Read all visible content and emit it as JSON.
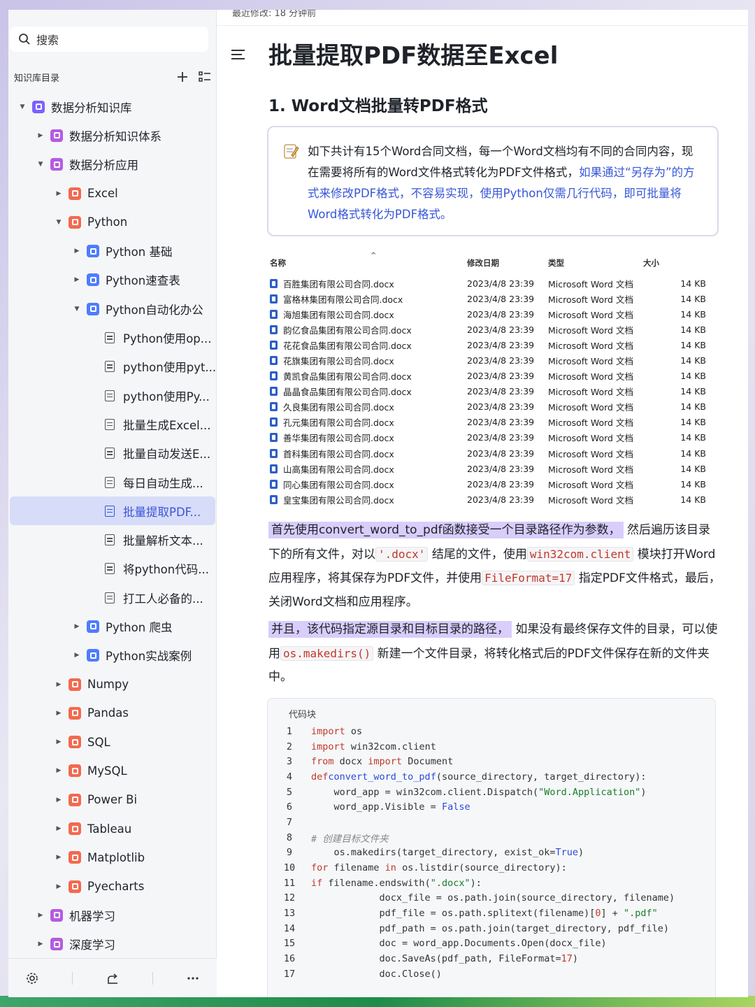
{
  "sidebar": {
    "search_placeholder": "搜索",
    "kb_title": "知识库目录",
    "items": [
      {
        "label": "数据分析知识库",
        "level": 0,
        "caret": "▼",
        "icon": "purple"
      },
      {
        "label": "数据分析知识体系",
        "level": 1,
        "caret": "▶",
        "icon": "pink"
      },
      {
        "label": "数据分析应用",
        "level": 1,
        "caret": "▼",
        "icon": "pink"
      },
      {
        "label": "Excel",
        "level": 2,
        "caret": "▶",
        "icon": "red"
      },
      {
        "label": "Python",
        "level": 2,
        "caret": "▼",
        "icon": "red"
      },
      {
        "label": "Python 基础",
        "level": 3,
        "caret": "▶",
        "icon": "blue"
      },
      {
        "label": "Python速查表",
        "level": 3,
        "caret": "▶",
        "icon": "blue"
      },
      {
        "label": "Python自动化办公",
        "level": 3,
        "caret": "▼",
        "icon": "blue"
      },
      {
        "label": "Python使用op...",
        "level": 4,
        "caret": "",
        "icon": "doc"
      },
      {
        "label": "python使用pyt...",
        "level": 4,
        "caret": "",
        "icon": "doc"
      },
      {
        "label": "python使用Py...",
        "level": 4,
        "caret": "",
        "icon": "doc"
      },
      {
        "label": "批量生成Excel...",
        "level": 4,
        "caret": "",
        "icon": "doc"
      },
      {
        "label": "批量自动发送E...",
        "level": 4,
        "caret": "",
        "icon": "doc"
      },
      {
        "label": "每日自动生成...",
        "level": 4,
        "caret": "",
        "icon": "doc"
      },
      {
        "label": "批量提取PDF...",
        "level": 4,
        "caret": "",
        "icon": "doc",
        "active": true
      },
      {
        "label": "批量解析文本...",
        "level": 4,
        "caret": "",
        "icon": "doc"
      },
      {
        "label": "将python代码...",
        "level": 4,
        "caret": "",
        "icon": "doc"
      },
      {
        "label": "打工人必备的...",
        "level": 4,
        "caret": "",
        "icon": "doc"
      },
      {
        "label": "Python 爬虫",
        "level": 3,
        "caret": "▶",
        "icon": "blue"
      },
      {
        "label": "Python实战案例",
        "level": 3,
        "caret": "▶",
        "icon": "blue"
      },
      {
        "label": "Numpy",
        "level": 2,
        "caret": "▶",
        "icon": "red"
      },
      {
        "label": "Pandas",
        "level": 2,
        "caret": "▶",
        "icon": "red"
      },
      {
        "label": "SQL",
        "level": 2,
        "caret": "▶",
        "icon": "red"
      },
      {
        "label": "MySQL",
        "level": 2,
        "caret": "▶",
        "icon": "red"
      },
      {
        "label": "Power Bi",
        "level": 2,
        "caret": "▶",
        "icon": "red"
      },
      {
        "label": "Tableau",
        "level": 2,
        "caret": "▶",
        "icon": "red"
      },
      {
        "label": "Matplotlib",
        "level": 2,
        "caret": "▶",
        "icon": "red"
      },
      {
        "label": "Pyecharts",
        "level": 2,
        "caret": "▶",
        "icon": "red"
      },
      {
        "label": "机器学习",
        "level": 1,
        "caret": "▶",
        "icon": "pink"
      },
      {
        "label": "深度学习",
        "level": 1,
        "caret": "▶",
        "icon": "pink"
      }
    ]
  },
  "main": {
    "last_modified": "最近修改: 18 分钟前",
    "title": "批量提取PDF数据至Excel",
    "section_heading": "1. Word文档批量转PDF格式",
    "callout_plain": "如下共计有15个Word合同文档，每一个Word文档均有不同的合同内容，现在需要将所有的Word文件格式转化为PDF文件格式，",
    "callout_blue": "如果通过“另存为”的方式来修改PDF格式，不容易实现，使用Python仅需几行代码，即可批量将Word格式转化为PDF格式。",
    "file_table": {
      "headers": [
        "名称",
        "修改日期",
        "类型",
        "大小"
      ],
      "rows": [
        [
          "百胜集团有限公司合同.docx",
          "2023/4/8 23:39",
          "Microsoft Word 文档",
          "14 KB"
        ],
        [
          "富格林集团有限公司合同.docx",
          "2023/4/8 23:39",
          "Microsoft Word 文档",
          "14 KB"
        ],
        [
          "海旭集团有限公司合同.docx",
          "2023/4/8 23:39",
          "Microsoft Word 文档",
          "14 KB"
        ],
        [
          "韵亿食品集团有限公司合同.docx",
          "2023/4/8 23:39",
          "Microsoft Word 文档",
          "14 KB"
        ],
        [
          "花花食品集团有限公司合同.docx",
          "2023/4/8 23:39",
          "Microsoft Word 文档",
          "14 KB"
        ],
        [
          "花旗集团有限公司合同.docx",
          "2023/4/8 23:39",
          "Microsoft Word 文档",
          "14 KB"
        ],
        [
          "黄凯食品集团有限公司合同.docx",
          "2023/4/8 23:39",
          "Microsoft Word 文档",
          "14 KB"
        ],
        [
          "晶晶食品集团有限公司合同.docx",
          "2023/4/8 23:39",
          "Microsoft Word 文档",
          "14 KB"
        ],
        [
          "久良集团有限公司合同.docx",
          "2023/4/8 23:39",
          "Microsoft Word 文档",
          "14 KB"
        ],
        [
          "孔元集团有限公司合同.docx",
          "2023/4/8 23:39",
          "Microsoft Word 文档",
          "14 KB"
        ],
        [
          "善华集团有限公司合同.docx",
          "2023/4/8 23:39",
          "Microsoft Word 文档",
          "14 KB"
        ],
        [
          "首科集团有限公司合同.docx",
          "2023/4/8 23:39",
          "Microsoft Word 文档",
          "14 KB"
        ],
        [
          "山高集团有限公司合同.docx",
          "2023/4/8 23:39",
          "Microsoft Word 文档",
          "14 KB"
        ],
        [
          "同心集团有限公司合同.docx",
          "2023/4/8 23:39",
          "Microsoft Word 文档",
          "14 KB"
        ],
        [
          "皇宝集团有限公司合同.docx",
          "2023/4/8 23:39",
          "Microsoft Word 文档",
          "14 KB"
        ]
      ]
    },
    "para1": {
      "hl": "首先使用convert_word_to_pdf函数接受一个目录路径作为参数，",
      "t1": "然后遍历该目录下的所有文件，对以",
      "c1": "'.docx'",
      "t2": "结尾的文件，使用",
      "c2": "win32com.client",
      "t3": "模块打开Word应用程序，将其保存为PDF文件，并使用",
      "c3": "FileFormat=17",
      "t4": "指定PDF文件格式，最后，关闭Word文档和应用程序。"
    },
    "para2": {
      "hl": "并且，该代码指定源目录和目标目录的路径，",
      "t1": "如果没有最终保存文件的目录，可以使用",
      "c1": "os.makedirs()",
      "t2": "新建一个文件目录，将转化格式后的PDF文件保存在新的文件夹中。"
    },
    "code_label": "代码块"
  }
}
